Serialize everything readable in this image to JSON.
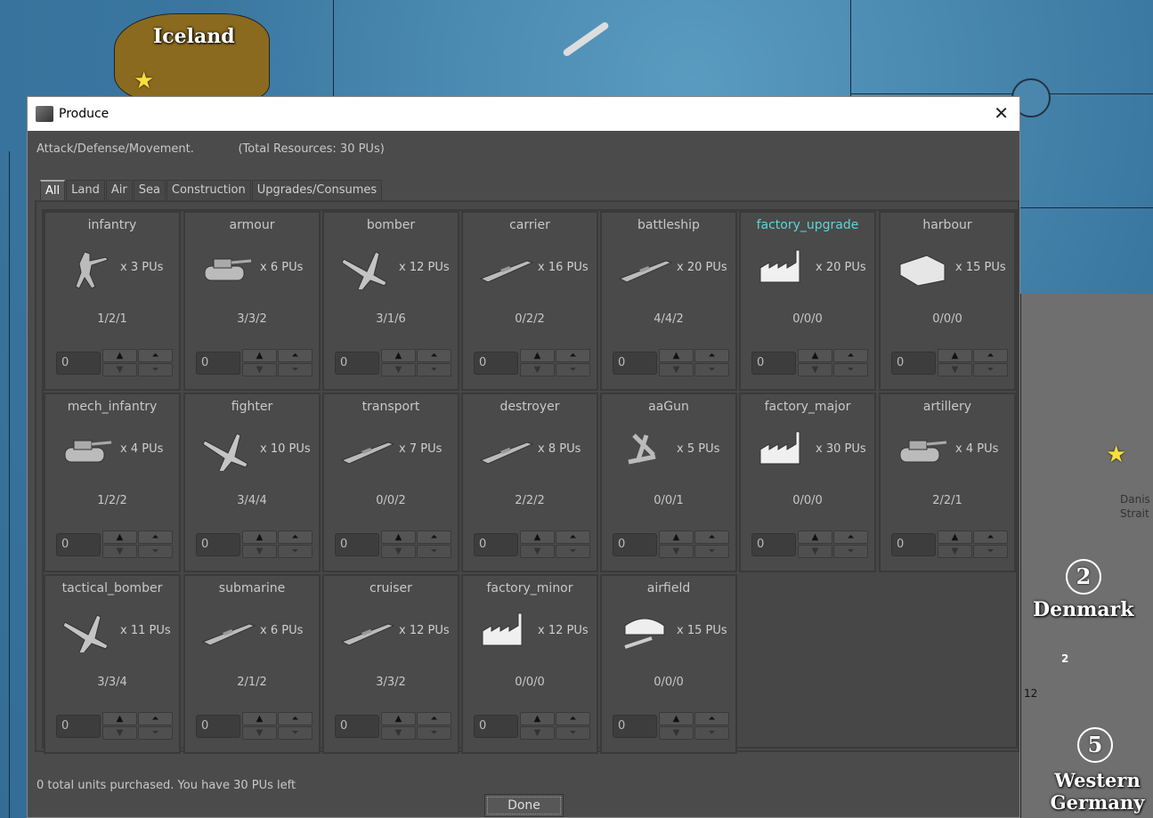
{
  "map": {
    "labels": {
      "iceland": "Iceland",
      "denmark": "Denmark",
      "western_germany": "Western Germany",
      "danish_strait": "Danis\nStrait"
    },
    "badges": {
      "denmark": "2",
      "western_germany": "5",
      "denmark_units": "2",
      "left_number": "12"
    }
  },
  "dialog": {
    "title": "Produce",
    "close": "✕",
    "info_left": "Attack/Defense/Movement.",
    "info_right": "(Total Resources: 30 PUs)",
    "tabs": [
      {
        "label": "All",
        "active": true
      },
      {
        "label": "Land"
      },
      {
        "label": "Air"
      },
      {
        "label": "Sea"
      },
      {
        "label": "Construction"
      },
      {
        "label": "Upgrades/Consumes"
      }
    ],
    "units": [
      {
        "name": "infantry",
        "cost": "x 3 PUs",
        "stats": "1/2/1",
        "qty": "0",
        "icon": "infantry-icon"
      },
      {
        "name": "armour",
        "cost": "x 6 PUs",
        "stats": "3/3/2",
        "qty": "0",
        "icon": "tank-icon"
      },
      {
        "name": "bomber",
        "cost": "x 12 PUs",
        "stats": "3/1/6",
        "qty": "0",
        "icon": "bomber-icon"
      },
      {
        "name": "carrier",
        "cost": "x 16 PUs",
        "stats": "0/2/2",
        "qty": "0",
        "icon": "carrier-icon"
      },
      {
        "name": "battleship",
        "cost": "x 20 PUs",
        "stats": "4/4/2",
        "qty": "0",
        "icon": "battleship-icon"
      },
      {
        "name": "factory_upgrade",
        "cost": "x 20 PUs",
        "stats": "0/0/0",
        "qty": "0",
        "icon": "factory-icon",
        "highlight": true
      },
      {
        "name": "harbour",
        "cost": "x 15 PUs",
        "stats": "0/0/0",
        "qty": "0",
        "icon": "harbour-icon"
      },
      {
        "name": "mech_infantry",
        "cost": "x 4 PUs",
        "stats": "1/2/2",
        "qty": "0",
        "icon": "halftrack-icon"
      },
      {
        "name": "fighter",
        "cost": "x 10 PUs",
        "stats": "3/4/4",
        "qty": "0",
        "icon": "fighter-icon"
      },
      {
        "name": "transport",
        "cost": "x 7 PUs",
        "stats": "0/0/2",
        "qty": "0",
        "icon": "transport-ship-icon"
      },
      {
        "name": "destroyer",
        "cost": "x 8 PUs",
        "stats": "2/2/2",
        "qty": "0",
        "icon": "destroyer-icon"
      },
      {
        "name": "aaGun",
        "cost": "x 5 PUs",
        "stats": "0/0/1",
        "qty": "0",
        "icon": "aa-gun-icon"
      },
      {
        "name": "factory_major",
        "cost": "x 30 PUs",
        "stats": "0/0/0",
        "qty": "0",
        "icon": "factory-icon"
      },
      {
        "name": "artillery",
        "cost": "x 4 PUs",
        "stats": "2/2/1",
        "qty": "0",
        "icon": "artillery-icon"
      },
      {
        "name": "tactical_bomber",
        "cost": "x 11 PUs",
        "stats": "3/3/4",
        "qty": "0",
        "icon": "tactical-bomber-icon"
      },
      {
        "name": "submarine",
        "cost": "x 6 PUs",
        "stats": "2/1/2",
        "qty": "0",
        "icon": "submarine-icon"
      },
      {
        "name": "cruiser",
        "cost": "x 12 PUs",
        "stats": "3/3/2",
        "qty": "0",
        "icon": "cruiser-icon"
      },
      {
        "name": "factory_minor",
        "cost": "x 12 PUs",
        "stats": "0/0/0",
        "qty": "0",
        "icon": "factory-icon"
      },
      {
        "name": "airfield",
        "cost": "x 15 PUs",
        "stats": "0/0/0",
        "qty": "0",
        "icon": "airfield-icon"
      }
    ],
    "stepper": {
      "up": "▲",
      "max": "⏶",
      "down": "▼",
      "min": "⏷"
    },
    "status": "0 total units purchased.  You have 30 PUs left",
    "done": "Done"
  }
}
